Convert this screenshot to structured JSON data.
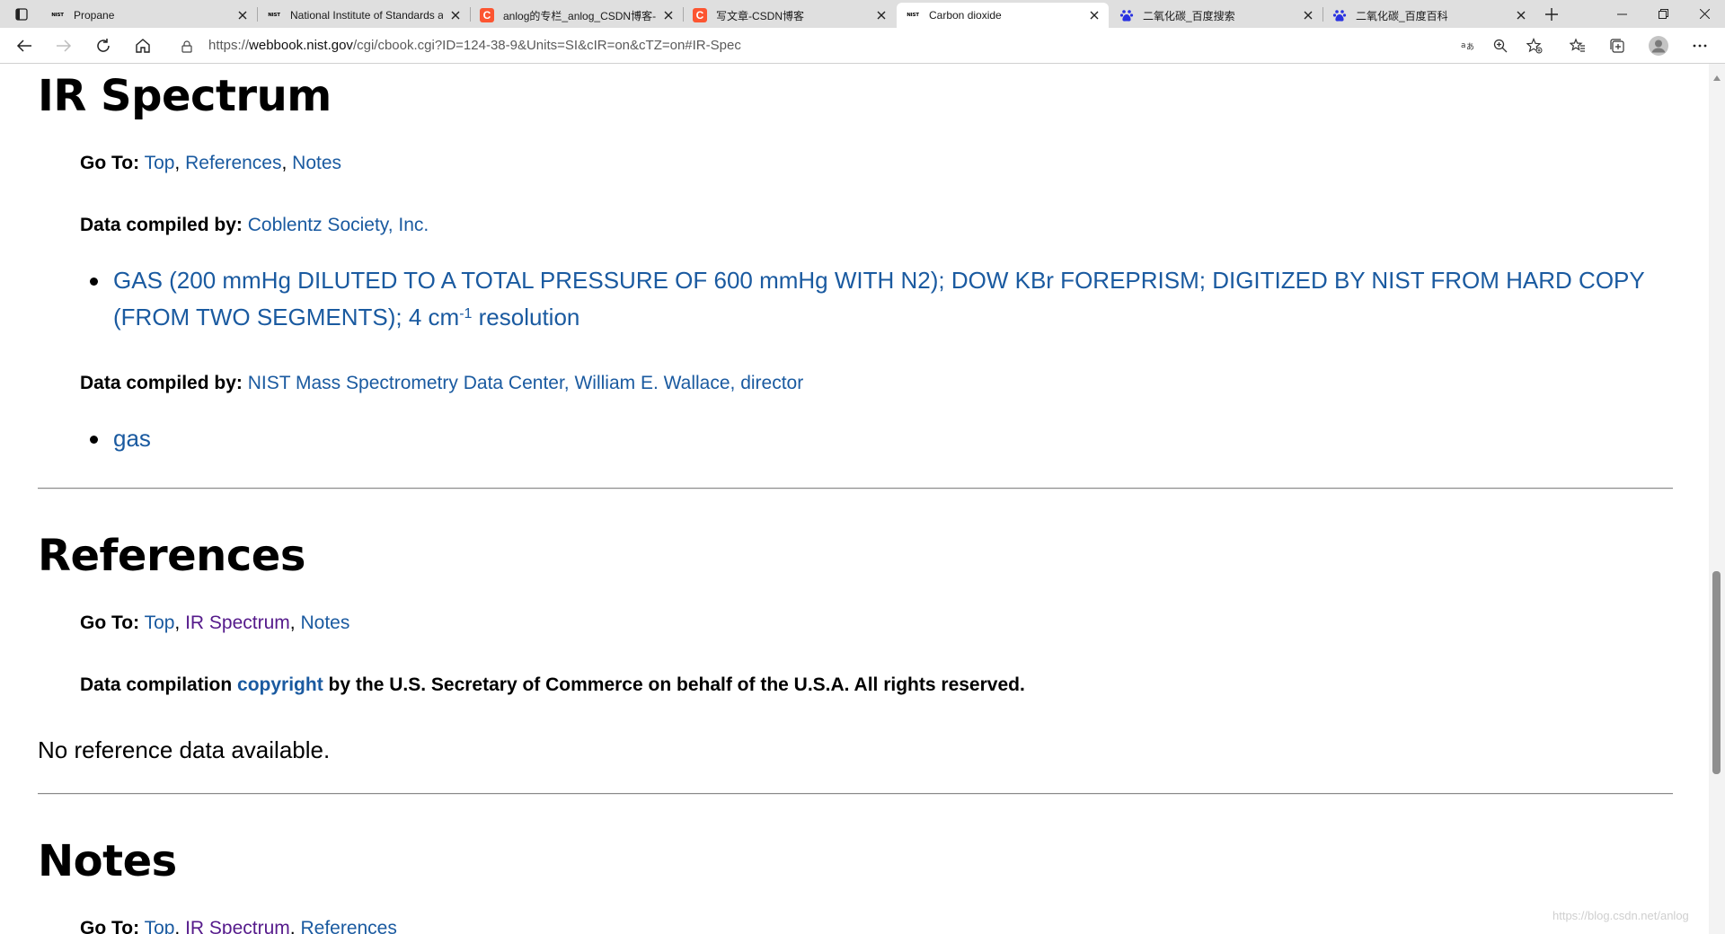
{
  "tabs": [
    {
      "title": "Propane",
      "favicon": "nist-icon",
      "active": false
    },
    {
      "title": "National Institute of Standards a",
      "favicon": "nist-icon",
      "active": false
    },
    {
      "title": "anlog的专栏_anlog_CSDN博客-l",
      "favicon": "csdn-icon",
      "active": false
    },
    {
      "title": "写文章-CSDN博客",
      "favicon": "csdn-icon",
      "active": false
    },
    {
      "title": "Carbon dioxide",
      "favicon": "nist-icon",
      "active": true
    },
    {
      "title": "二氧化碳_百度搜索",
      "favicon": "baidu-icon",
      "active": false
    },
    {
      "title": "二氧化碳_百度百科",
      "favicon": "baidu-icon",
      "active": false
    }
  ],
  "nist_favicon_text": "NIST",
  "csdn_favicon_text": "C",
  "address": {
    "prefix": "https://",
    "domain": "webbook.nist.gov",
    "path": "/cgi/cbook.cgi?ID=124-38-9&Units=SI&cIR=on&cTZ=on#IR-Spec"
  },
  "ir_section": {
    "heading": "IR Spectrum",
    "goto_label": "Go To:",
    "goto_links": [
      "Top",
      "References",
      "Notes"
    ],
    "compiled1_label": "Data compiled by:",
    "compiled1_value": "Coblentz Society, Inc.",
    "item1_text": "GAS (200 mmHg DILUTED TO A TOTAL PRESSURE OF 600 mmHg WITH N2); DOW KBr FOREPRISM; DIGITIZED BY NIST FROM HARD COPY (FROM TWO SEGMENTS); 4 cm",
    "item1_sup": "-1",
    "item1_tail": " resolution",
    "compiled2_label": "Data compiled by:",
    "compiled2_value": "NIST Mass Spectrometry Data Center, William E. Wallace, director",
    "item2_text": "gas"
  },
  "references_section": {
    "heading": "References",
    "goto_label": "Go To:",
    "goto_links": [
      "Top",
      "IR Spectrum",
      "Notes"
    ],
    "copyright_before": "Data compilation ",
    "copyright_link": "copyright",
    "copyright_after": " by the U.S. Secretary of Commerce on behalf of the U.S.A. All rights reserved.",
    "no_data": "No reference data available."
  },
  "notes_section": {
    "heading": "Notes",
    "goto_label": "Go To:",
    "goto_links": [
      "Top",
      "IR Spectrum",
      "References"
    ]
  },
  "watermark": "https://blog.csdn.net/anlog",
  "colors": {
    "link": "#1a5aa0",
    "visited_link": "#551a8b",
    "tabstrip": "#dfdfdf",
    "csdn_favicon": "#fc5531"
  }
}
